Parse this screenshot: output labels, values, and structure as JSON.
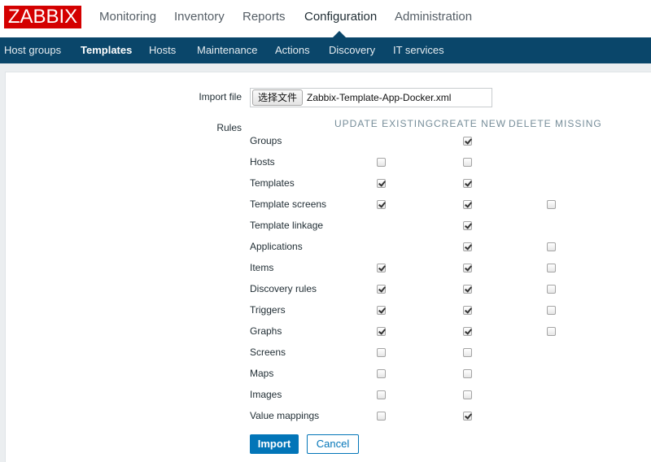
{
  "brand": {
    "logo_text": "ZABBIX",
    "color": "#d40000"
  },
  "main_nav": [
    {
      "label": "Monitoring",
      "active": false
    },
    {
      "label": "Inventory",
      "active": false
    },
    {
      "label": "Reports",
      "active": false
    },
    {
      "label": "Configuration",
      "active": true
    },
    {
      "label": "Administration",
      "active": false
    }
  ],
  "sub_nav": [
    {
      "label": "Host groups",
      "active": false
    },
    {
      "label": "Templates",
      "active": true
    },
    {
      "label": "Hosts",
      "active": false
    },
    {
      "label": "Maintenance",
      "active": false
    },
    {
      "label": "Actions",
      "active": false
    },
    {
      "label": "Discovery",
      "active": false
    },
    {
      "label": "IT services",
      "active": false
    }
  ],
  "form": {
    "import_file_label": "Import file",
    "choose_file_label": "选择文件",
    "file_name": "Zabbix-Template-App-Docker.xml",
    "rules_label": "Rules",
    "columns": [
      "UPDATE EXISTING",
      "CREATE NEW",
      "DELETE MISSING"
    ],
    "rules": [
      {
        "name": "Groups",
        "update": null,
        "create": true,
        "delete": null
      },
      {
        "name": "Hosts",
        "update": false,
        "create": false,
        "delete": null
      },
      {
        "name": "Templates",
        "update": true,
        "create": true,
        "delete": null
      },
      {
        "name": "Template screens",
        "update": true,
        "create": true,
        "delete": false
      },
      {
        "name": "Template linkage",
        "update": null,
        "create": true,
        "delete": null
      },
      {
        "name": "Applications",
        "update": null,
        "create": true,
        "delete": false
      },
      {
        "name": "Items",
        "update": true,
        "create": true,
        "delete": false
      },
      {
        "name": "Discovery rules",
        "update": true,
        "create": true,
        "delete": false
      },
      {
        "name": "Triggers",
        "update": true,
        "create": true,
        "delete": false
      },
      {
        "name": "Graphs",
        "update": true,
        "create": true,
        "delete": false
      },
      {
        "name": "Screens",
        "update": false,
        "create": false,
        "delete": null
      },
      {
        "name": "Maps",
        "update": false,
        "create": false,
        "delete": null
      },
      {
        "name": "Images",
        "update": false,
        "create": false,
        "delete": null
      },
      {
        "name": "Value mappings",
        "update": false,
        "create": true,
        "delete": null
      }
    ],
    "import_button": "Import",
    "cancel_button": "Cancel"
  },
  "colors": {
    "header_bg": "#0a466a",
    "accent": "#0275b8",
    "page_bg": "#ebeef0"
  }
}
